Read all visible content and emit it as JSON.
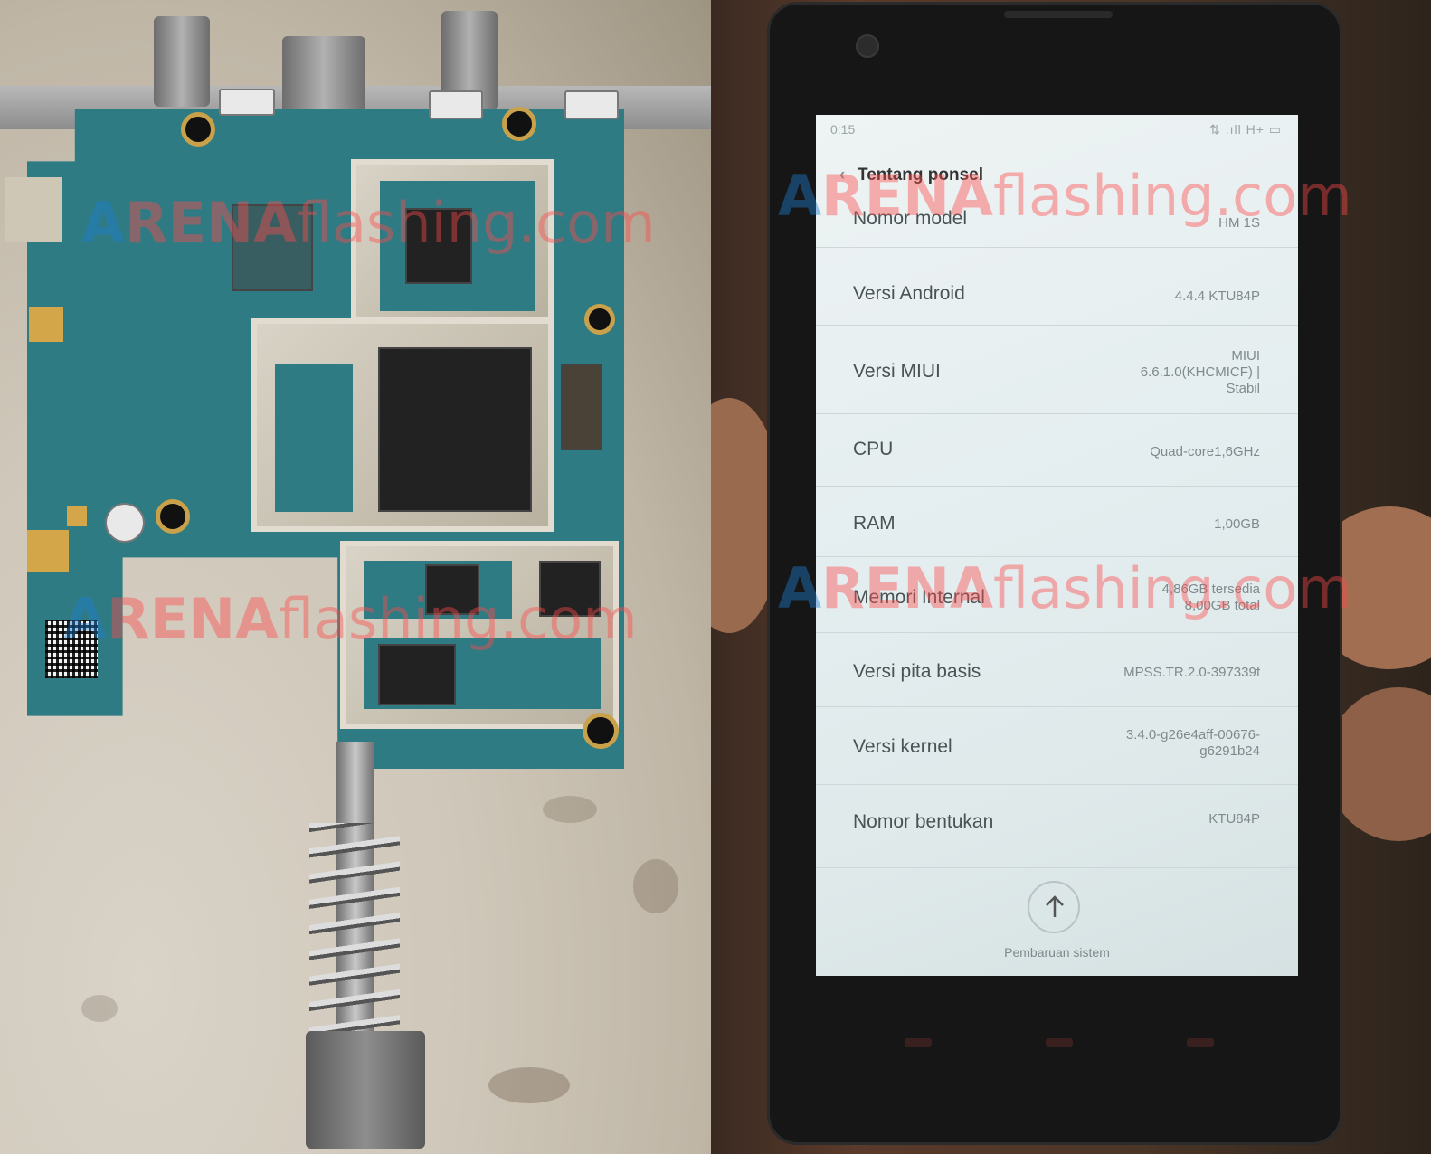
{
  "watermark": {
    "part1": "A",
    "part2": "RENA",
    "part3": "flashing.com"
  },
  "phone": {
    "status_time": "0:15",
    "status_icons": "⇅ .ıll H+ ▭",
    "header": "Tentang ponsel",
    "rows": [
      {
        "label": "Nomor model",
        "value": "HM 1S"
      },
      {
        "label": "Versi Android",
        "value": "4.4.4 KTU84P"
      },
      {
        "label": "Versi MIUI",
        "value": "MIUI\n6.6.1.0(KHCMICF) |\nStabil"
      },
      {
        "label": "CPU",
        "value": "Quad-core1,6GHz"
      },
      {
        "label": "RAM",
        "value": "1,00GB"
      },
      {
        "label": "Memori Internal",
        "value": "4,86GB tersedia\n8,00GB total"
      },
      {
        "label": "Versi pita basis",
        "value": "MPSS.TR.2.0-397339f"
      },
      {
        "label": "Versi kernel",
        "value": "3.4.0-g26e4aff-00676-\ng6291b24"
      },
      {
        "label": "Nomor bentukan",
        "value": "KTU84P"
      }
    ],
    "update_label": "Pembaruan sistem"
  },
  "colors": {
    "pcb": "#2e7b84",
    "screen": "#e5eef0",
    "watermark_blue": "#1e7fd6",
    "watermark_red": "#ff4a4a"
  }
}
